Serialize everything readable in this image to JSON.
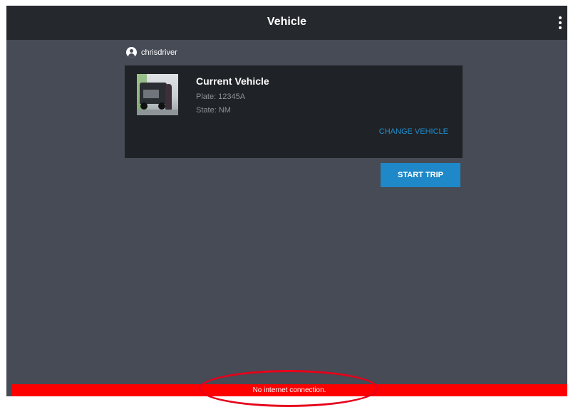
{
  "topbar": {
    "title": "Vehicle",
    "menu_icon": "overflow-menu-icon"
  },
  "user": {
    "name": "chrisdriver",
    "icon": "account-circle-icon"
  },
  "vehicle_card": {
    "heading": "Current Vehicle",
    "plate": "Plate: 12345A",
    "state": "State: NM",
    "change_label": "CHANGE VEHICLE",
    "image": "vehicle-photo"
  },
  "actions": {
    "start_trip_label": "START TRIP"
  },
  "status_bar": {
    "message": "No internet connection."
  },
  "colors": {
    "background": "#464b55",
    "topbar": "#25282d",
    "card": "#1f2226",
    "accent": "#1e88c8",
    "error": "#ff0000",
    "annotation": "#e6001a"
  }
}
